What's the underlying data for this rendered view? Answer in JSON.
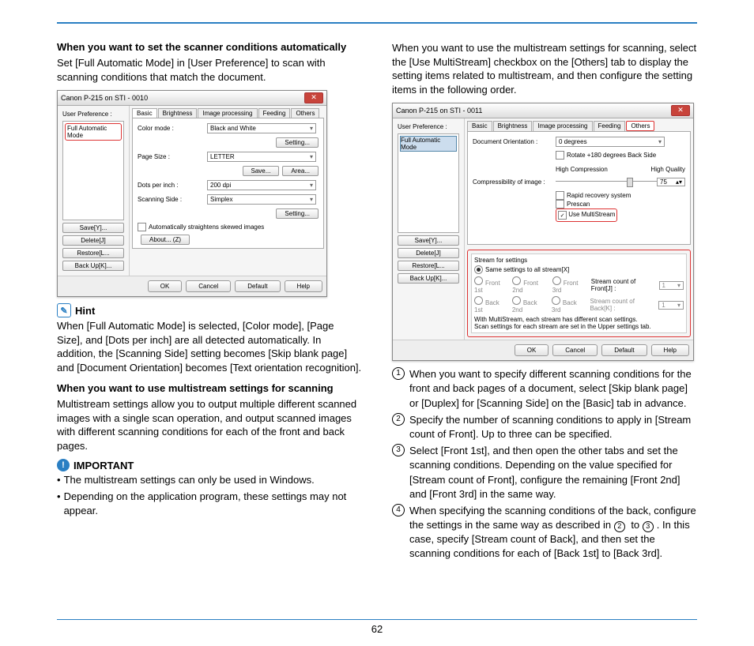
{
  "page_number": "62",
  "col1": {
    "h1": "When you want to set the scanner conditions automatically",
    "p1": "Set [Full Automatic Mode] in [User Preference] to scan with scanning conditions that match the document.",
    "hint_label": "Hint",
    "hint_text": "When [Full Automatic Mode] is selected, [Color mode], [Page Size], and [Dots per inch] are all detected automatically. In addition, the [Scanning Side] setting becomes [Skip blank page] and [Document Orientation] becomes [Text orientation recognition].",
    "h2": "When you want to use multistream settings for scanning",
    "p2": "Multistream settings allow you to output multiple different scanned images with a single scan operation, and output scanned images with different scanning conditions for each of the front and back pages.",
    "important_label": "IMPORTANT",
    "imp1": "The multistream settings can only be used in Windows.",
    "imp2": "Depending on the application program, these settings may not appear."
  },
  "col2": {
    "intro": "When you want to use the multistream settings for scanning, select the [Use MultiStream] checkbox on the [Others] tab to display the setting items related to multistream, and then configure the setting items in the following order.",
    "steps": {
      "s1": "When you want to specify different scanning conditions for the front and back pages of a document, select [Skip blank page] or [Duplex] for [Scanning Side] on the [Basic] tab in advance.",
      "s2": "Specify the number of scanning conditions to apply in [Stream count of Front]. Up to three can be specified.",
      "s3": "Select [Front 1st], and then open the other tabs and set the scanning conditions. Depending on the value specified for [Stream count of Front], configure the remaining [Front 2nd] and [Front 3rd] in the same way.",
      "s4_a": "When specifying the scanning conditions of the back, configure the settings in the same way as described in ",
      "s4_b": " to ",
      "s4_c": ". In this case, specify [Stream count of Back], and then set the scanning conditions for each of [Back 1st] to [Back 3rd]."
    }
  },
  "dlg": {
    "title": "Canon P-215 on STI - 0010",
    "userpref": "User Preference :",
    "fullauto": "Full Automatic Mode",
    "save": "Save[Y]...",
    "delete": "Delete[J]",
    "restore": "Restore[L...",
    "backup": "Back Up[K]...",
    "tabs": {
      "basic": "Basic",
      "brightness": "Brightness",
      "image": "Image processing",
      "feeding": "Feeding",
      "others": "Others"
    },
    "basic": {
      "color": "Color mode :",
      "color_v": "Black and White",
      "setting": "Setting...",
      "page": "Page Size :",
      "page_v": "LETTER",
      "savebtn": "Save...",
      "area": "Area...",
      "dpi": "Dots per inch :",
      "dpi_v": "200 dpi",
      "side": "Scanning Side :",
      "side_v": "Simplex",
      "auto": "Automatically straightens skewed images",
      "about": "About...  (Z)"
    },
    "foot": {
      "ok": "OK",
      "cancel": "Cancel",
      "default": "Default",
      "help": "Help"
    }
  },
  "dlg2": {
    "title": "Canon P-215 on STI - 0011",
    "others": {
      "docorient": "Document Orientation :",
      "docorient_v": "0 degrees",
      "rotate": "Rotate +180 degrees Back Side",
      "comp": "Compressibility of image :",
      "highcomp": "High Compression",
      "highqual": "High Quality",
      "comp_v": "75",
      "rapid": "Rapid recovery system",
      "prescan": "Prescan",
      "multi": "Use MultiStream"
    },
    "stream": {
      "header": "Stream for settings",
      "same": "Same settings to all stream[X]",
      "f1": "Front 1st",
      "f2": "Front 2nd",
      "f3": "Front 3rd",
      "b1": "Back 1st",
      "b2": "Back 2nd",
      "b3": "Back 3rd",
      "scf": "Stream count of Front[J] :",
      "scf_v": "1",
      "scb": "Stream count of Back[K] :",
      "scb_v": "1",
      "note": "With MultiStream, each stream has different scan settings.\nScan settings for each stream are set in the Upper settings tab."
    }
  }
}
